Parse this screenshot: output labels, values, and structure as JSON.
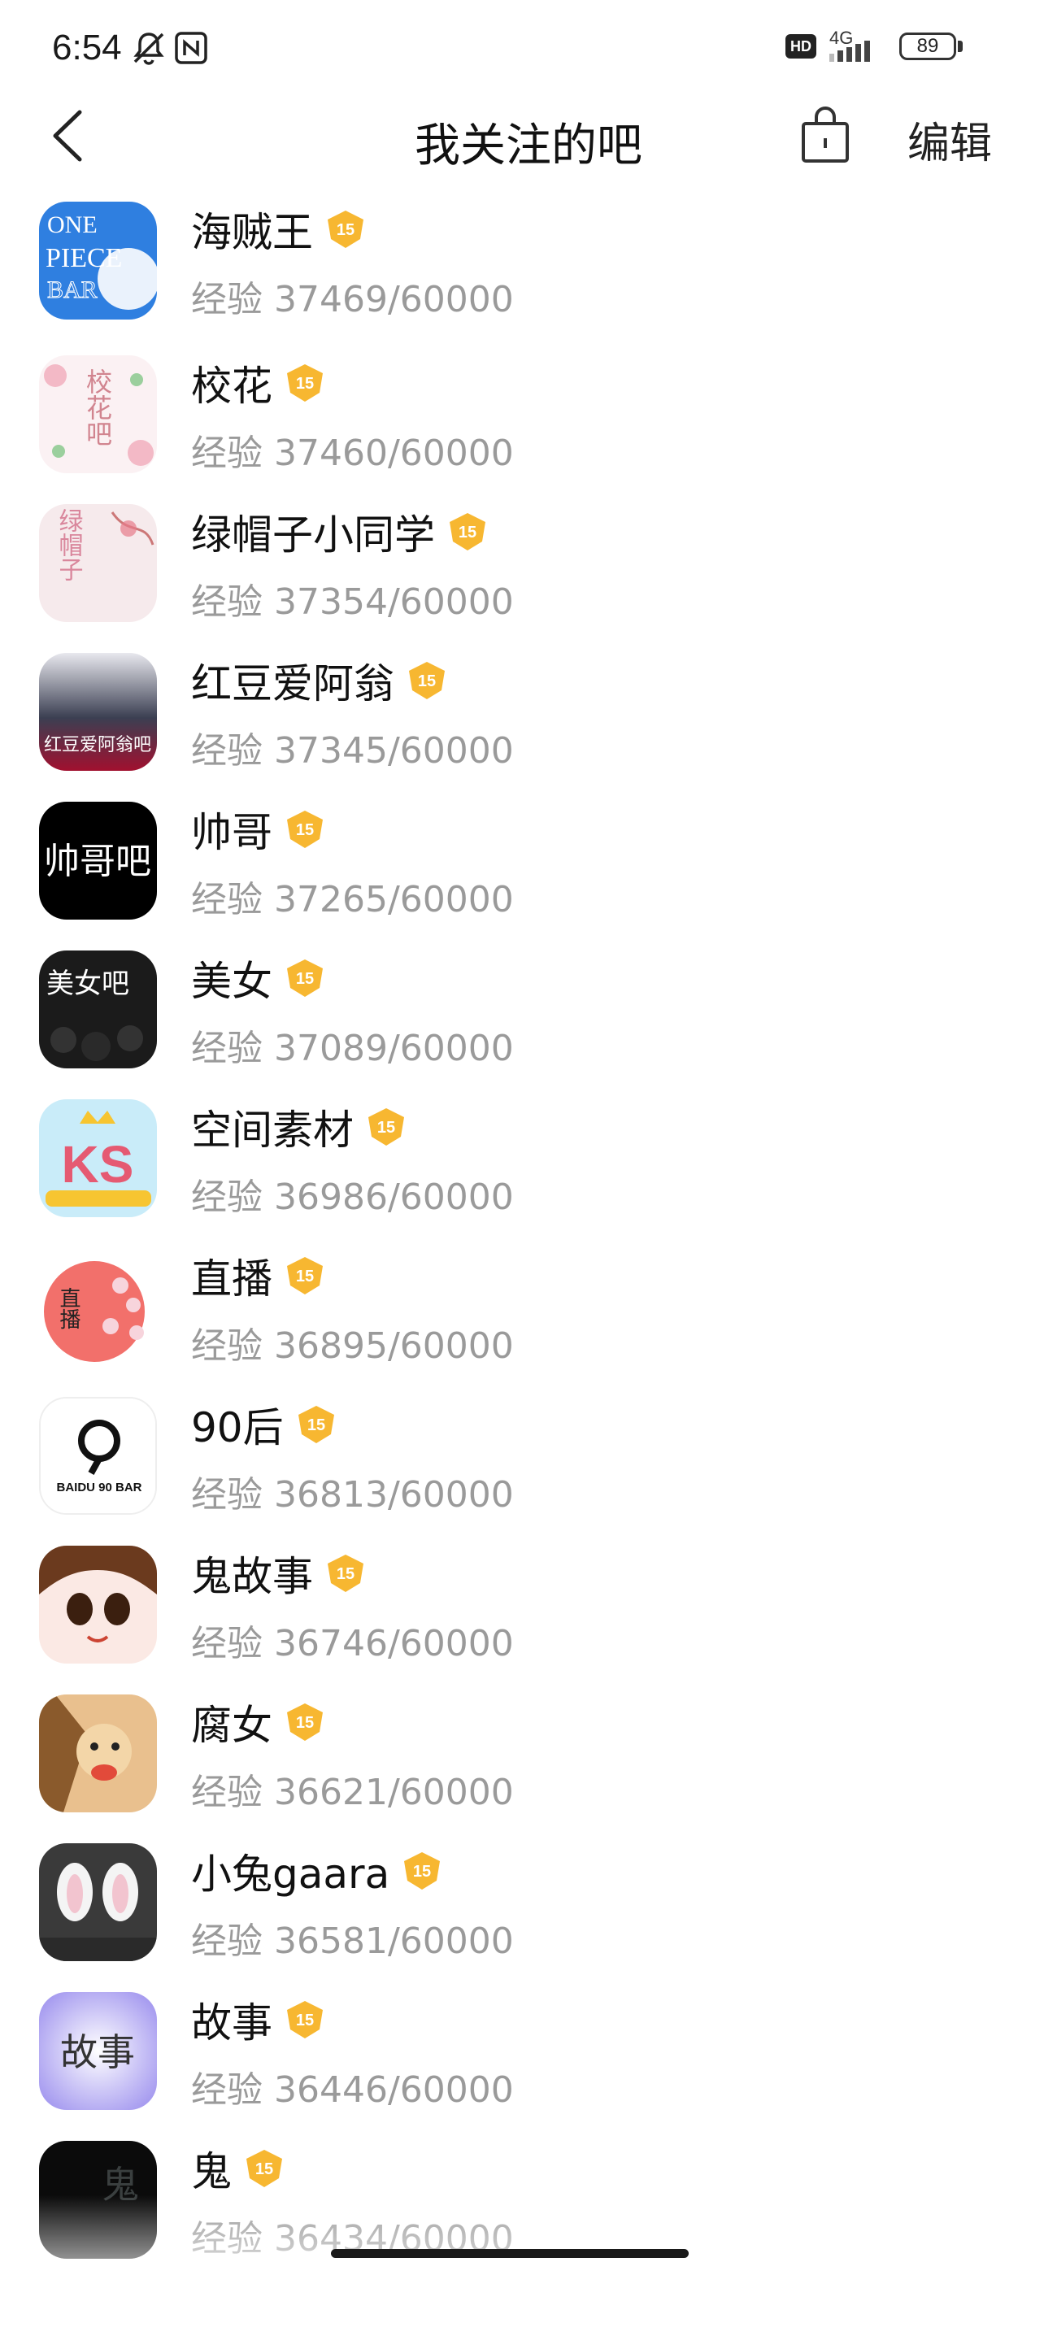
{
  "status_bar": {
    "time": "6:54",
    "hd": "HD",
    "network": "4G",
    "battery": "89"
  },
  "header": {
    "back_icon": "chevron-left-icon",
    "title": "我关注的吧",
    "bag_icon": "shopping-bag-icon",
    "edit_label": "编辑"
  },
  "exp_label": "经验",
  "list": [
    {
      "name": "海贼王",
      "level": "15",
      "exp": "37469/60000",
      "accent": "#2f7fe0"
    },
    {
      "name": "校花",
      "level": "15",
      "exp": "37460/60000",
      "accent": "#f6dde3"
    },
    {
      "name": "绿帽子小同学",
      "level": "15",
      "exp": "37354/60000",
      "accent": "#f4e7ea"
    },
    {
      "name": "红豆爱阿翁",
      "level": "15",
      "exp": "37345/60000",
      "accent": "#b3103b"
    },
    {
      "name": "帅哥",
      "level": "15",
      "exp": "37265/60000",
      "accent": "#000000"
    },
    {
      "name": "美女",
      "level": "15",
      "exp": "37089/60000",
      "accent": "#1b1b1b"
    },
    {
      "name": "空间素材",
      "level": "15",
      "exp": "36986/60000",
      "accent": "#bfe6f7"
    },
    {
      "name": "直播",
      "level": "15",
      "exp": "36895/60000",
      "accent": "#f2706b"
    },
    {
      "name": "90后",
      "level": "15",
      "exp": "36813/60000",
      "accent": "#ffffff"
    },
    {
      "name": "鬼故事",
      "level": "15",
      "exp": "36746/60000",
      "accent": "#6b3a1e"
    },
    {
      "name": "腐女",
      "level": "15",
      "exp": "36621/60000",
      "accent": "#e0a36a"
    },
    {
      "name": "小兔gaara",
      "level": "15",
      "exp": "36581/60000",
      "accent": "#3c3c3c"
    },
    {
      "name": "故事",
      "level": "15",
      "exp": "36446/60000",
      "accent": "#c9c0f4"
    },
    {
      "name": "鬼",
      "level": "15",
      "exp": "36434/60000",
      "accent": "#0b0b0b"
    }
  ],
  "avatar_text": {
    "one_piece": [
      "ONE",
      "PIECE",
      "BAR"
    ],
    "xiaohua": "校花吧",
    "lvmaozi": "绿帽子",
    "hongdou": "红豆爱阿翁吧",
    "shuaige": "帅哥吧",
    "meinv": "美女吧",
    "kongjian": "KS",
    "zhibo": "直播",
    "nine_zero": "BAIDU 90 BAR",
    "gushi": "故事",
    "gui": "鬼"
  },
  "colors": {
    "badge": "#f7b731",
    "exp_text": "#9a9a9a"
  }
}
